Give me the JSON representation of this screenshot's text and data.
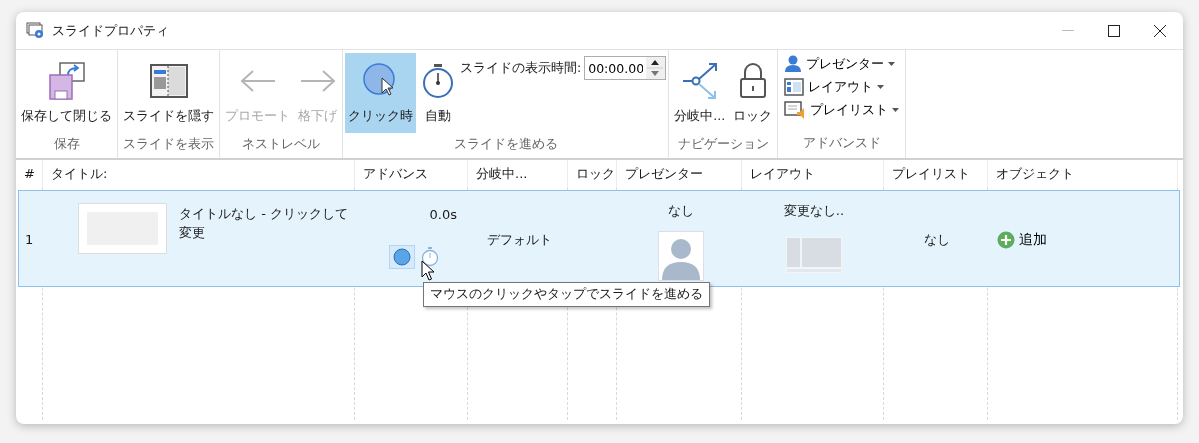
{
  "window": {
    "title": "スライドプロパティ"
  },
  "ribbon": {
    "groups": [
      {
        "label": "保存",
        "items": [
          {
            "kind": "large",
            "label": "保存して閉じる",
            "disabled": false,
            "selected": false
          }
        ]
      },
      {
        "label": "スライドを表示",
        "items": [
          {
            "kind": "large",
            "label": "スライドを隠す",
            "disabled": false,
            "selected": false
          }
        ]
      },
      {
        "label": "ネストレベル",
        "items": [
          {
            "kind": "large",
            "label": "プロモート",
            "disabled": true,
            "selected": false
          },
          {
            "kind": "large",
            "label": "格下げ",
            "disabled": true,
            "selected": false
          }
        ]
      },
      {
        "label": "スライドを進める",
        "items": [
          {
            "kind": "large",
            "label": "クリック時",
            "disabled": false,
            "selected": true
          },
          {
            "kind": "large",
            "label": "自動",
            "disabled": false,
            "selected": false
          },
          {
            "kind": "time",
            "label": "スライドの表示時間:",
            "value": "00:00.00"
          }
        ]
      },
      {
        "label": "ナビゲーション",
        "items": [
          {
            "kind": "large",
            "label": "分岐中...",
            "disabled": false,
            "selected": false
          },
          {
            "kind": "large",
            "label": "ロック",
            "disabled": false,
            "selected": false
          }
        ]
      },
      {
        "label": "アドバンスド",
        "items": [
          {
            "kind": "small",
            "label": "プレゼンター"
          },
          {
            "kind": "small",
            "label": "レイアウト"
          },
          {
            "kind": "small",
            "label": "プレイリスト"
          }
        ]
      }
    ]
  },
  "table": {
    "columns": [
      "#",
      "タイトル:",
      "アドバンス",
      "分岐中...",
      "ロック",
      "プレゼンター",
      "レイアウト",
      "プレイリスト",
      "オブジェクト"
    ],
    "rows": [
      {
        "selected": true,
        "number": "1",
        "title": "タイトルなし - クリックして変更",
        "advance": "0.0s",
        "advance_modes": [
          {
            "selected": true
          },
          {
            "selected": false
          }
        ],
        "branch": "デフォルト",
        "presenter": "なし",
        "layout": "変更なし..",
        "playlist": "なし",
        "object": "追加"
      }
    ]
  },
  "tooltip": "マウスのクリックやタップでスライドを進める"
}
